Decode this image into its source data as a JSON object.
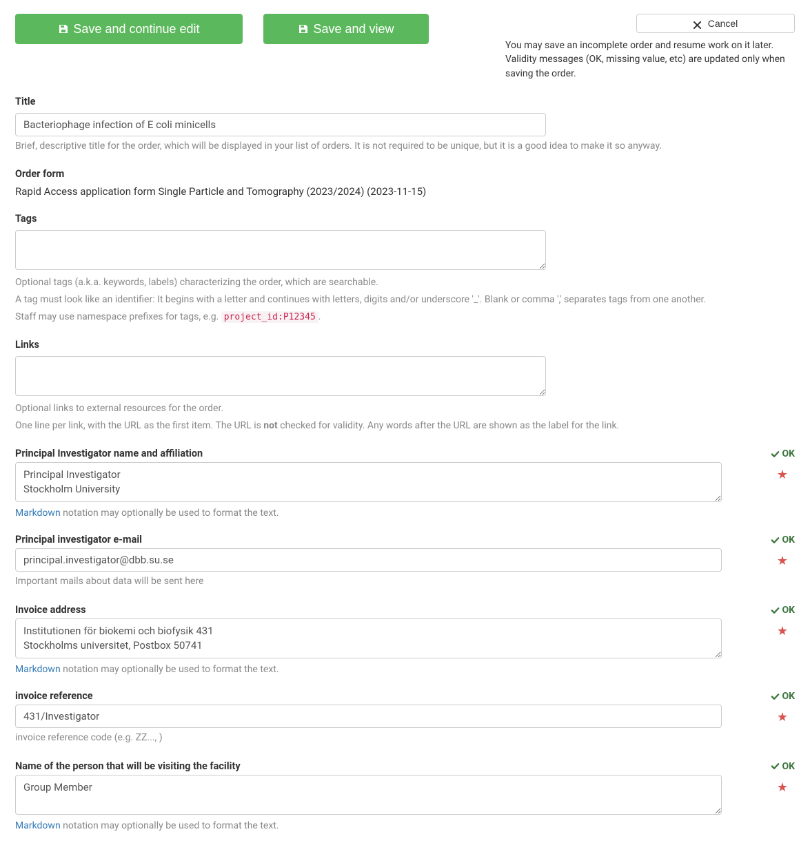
{
  "buttons": {
    "save_edit": "Save and continue edit",
    "save_view": "Save and view",
    "cancel": "Cancel"
  },
  "info": {
    "line1": "You may save an incomplete order and resume work on it later.",
    "line2": "Validity messages (OK, missing value, etc) are updated only when saving the order."
  },
  "title": {
    "label": "Title",
    "value": "Bacteriophage infection of E coli minicells",
    "hint": "Brief, descriptive title for the order, which will be displayed in your list of orders. It is not required to be unique, but it is a good idea to make it so anyway."
  },
  "order_form": {
    "label": "Order form",
    "value": "Rapid Access application form Single Particle and Tomography (2023/2024) (2023-11-15)"
  },
  "tags": {
    "label": "Tags",
    "value": "",
    "hint1": "Optional tags (a.k.a. keywords, labels) characterizing the order, which are searchable.",
    "hint2": "A tag must look like an identifier: It begins with a letter and continues with letters, digits and/or underscore '_'. Blank or comma ',' separates tags from one another.",
    "hint3_prefix": "Staff may use namespace prefixes for tags, e.g. ",
    "hint3_code": "project_id:P12345",
    "hint3_suffix": "."
  },
  "links": {
    "label": "Links",
    "value": "",
    "hint1": "Optional links to external resources for the order.",
    "hint2_prefix": "One line per link, with the URL as the first item. The URL is ",
    "hint2_bold": "not",
    "hint2_suffix": " checked for validity. Any words after the URL are shown as the label for the link."
  },
  "status_ok": "OK",
  "markdown": {
    "link": "Markdown",
    "suffix": " notation may optionally be used to format the text."
  },
  "pi_name": {
    "label": "Principal Investigator name and affiliation",
    "value": "Principal Investigator\nStockholm University"
  },
  "pi_email": {
    "label": "Principal investigator e-mail",
    "value": "principal.investigator@dbb.su.se",
    "hint": "Important mails about data will be sent here"
  },
  "invoice_addr": {
    "label": "Invoice address",
    "value": "Institutionen för biokemi och biofysik 431\nStockholms universitet, Postbox 50741"
  },
  "invoice_ref": {
    "label": "invoice reference",
    "value": "431/Investigator",
    "hint": "invoice reference code (e.g. ZZ..., )"
  },
  "visitor": {
    "label": "Name of the person that will be visiting the facility",
    "value": "Group Member"
  }
}
